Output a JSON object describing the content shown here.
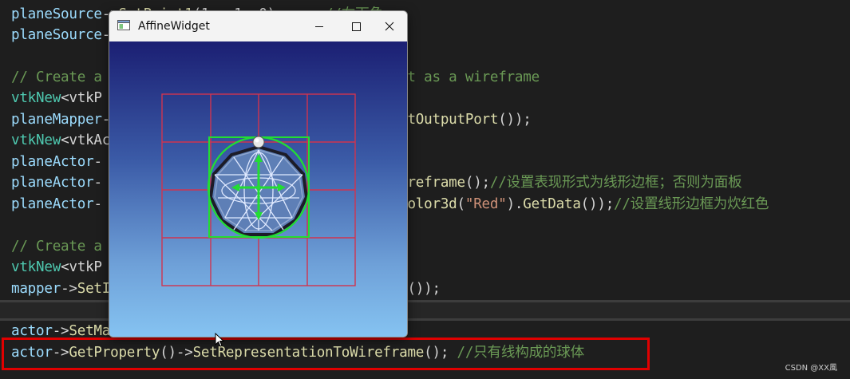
{
  "editor": {
    "lines": [
      [
        [
          "tok-var",
          "planeSource"
        ],
        [
          "tok-op",
          "->"
        ],
        [
          "tok-fn",
          "SetPoint1"
        ],
        [
          "tok-op",
          "(1, -1, 0);     "
        ],
        [
          "tok-comment",
          "//右下角"
        ]
      ],
      [
        [
          "tok-var",
          "planeSource"
        ],
        [
          "tok-op",
          "->"
        ]
      ],
      [],
      [
        [
          "tok-comment",
          "// Create a                                 ow it as a wireframe"
        ]
      ],
      [
        [
          "tok-type",
          "vtkNew"
        ],
        [
          "tok-op",
          "<vtkP"
        ]
      ],
      [
        [
          "tok-var",
          "planeMapper"
        ],
        [
          "tok-op",
          "-                                   "
        ],
        [
          "tok-fn",
          "etOutputPort"
        ],
        [
          "tok-op",
          "());"
        ]
      ],
      [
        [
          "tok-type",
          "vtkNew"
        ],
        [
          "tok-op",
          "<vtkAc"
        ]
      ],
      [
        [
          "tok-var",
          "planeActor"
        ],
        [
          "tok-op",
          "-"
        ]
      ],
      [
        [
          "tok-var",
          "planeActor"
        ],
        [
          "tok-op",
          "-                                   "
        ],
        [
          "tok-fn",
          "Wireframe"
        ],
        [
          "tok-op",
          "();"
        ],
        [
          "tok-comment",
          "//设置表现形式为线形边框；否则为面板"
        ]
      ],
      [
        [
          "tok-var",
          "planeActor"
        ],
        [
          "tok-op",
          "-                                   "
        ],
        [
          "tok-fn",
          "tColor3d"
        ],
        [
          "tok-op",
          "("
        ],
        [
          "tok-str",
          "\"Red\""
        ],
        [
          "tok-op",
          ")."
        ],
        [
          "tok-fn",
          "GetData"
        ],
        [
          "tok-op",
          "());"
        ],
        [
          "tok-comment",
          "//设置线形边框为炊红色"
        ]
      ],
      [],
      [
        [
          "tok-comment",
          "// Create a"
        ]
      ],
      [
        [
          "tok-type",
          "vtkNew"
        ],
        [
          "tok-op",
          "<vtkP"
        ]
      ],
      [
        [
          "tok-var",
          "mapper"
        ],
        [
          "tok-op",
          "->"
        ],
        [
          "tok-fn",
          "SetI"
        ],
        [
          "tok-op",
          "                                  "
        ],
        [
          "tok-fn",
          "rt"
        ],
        [
          "tok-op",
          "());"
        ]
      ],
      [
        [
          "tok-type",
          "vtkNew"
        ],
        [
          "tok-op",
          "<vtkAc"
        ]
      ],
      [
        [
          "tok-var",
          "actor"
        ],
        [
          "tok-op",
          "->"
        ],
        [
          "tok-fn",
          "SetMa"
        ]
      ],
      [
        [
          "tok-var",
          "actor"
        ],
        [
          "tok-op",
          "->"
        ],
        [
          "tok-fn",
          "GetProperty"
        ],
        [
          "tok-op",
          "()->"
        ],
        [
          "tok-fn",
          "SetRepresentationToWireframe"
        ],
        [
          "tok-op",
          "(); "
        ],
        [
          "tok-comment",
          "//只有线构成的球体"
        ]
      ]
    ]
  },
  "window": {
    "title": "AffineWidget"
  },
  "watermark": "CSDN @XX風",
  "colors": {
    "highlight": "#e00000",
    "plane_wire": "#d0344f",
    "widget_green": "#22dd33",
    "background_top": "#1b1f73",
    "background_bottom": "#86c4f2"
  },
  "icons": {
    "app": "window-app-icon",
    "minimize": "minimize-icon",
    "maximize": "maximize-icon",
    "close": "close-icon",
    "cursor": "mouse-pointer-icon"
  }
}
